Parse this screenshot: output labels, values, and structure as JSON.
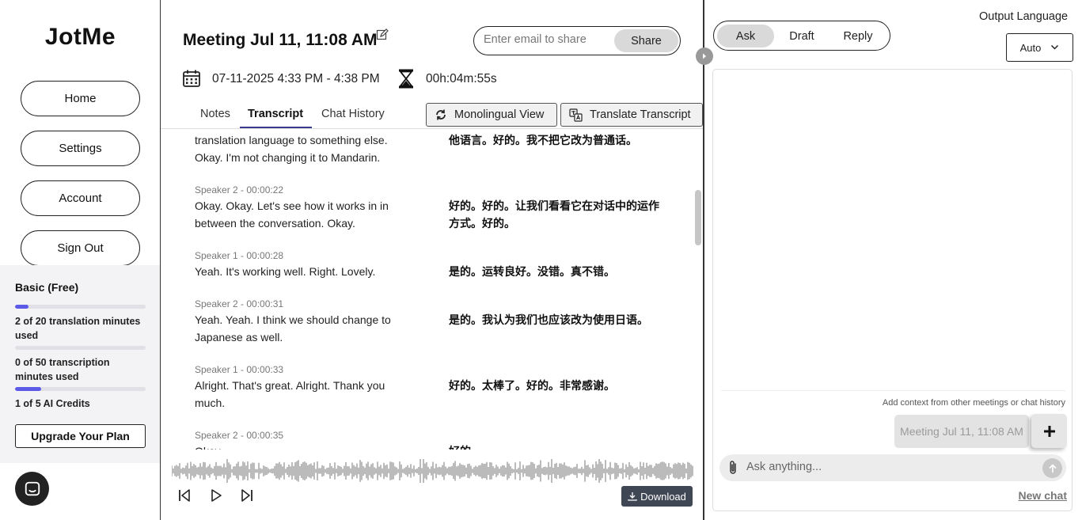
{
  "app": {
    "logo": "JotMe"
  },
  "sidebar": {
    "nav": [
      {
        "label": "Home"
      },
      {
        "label": "Settings"
      },
      {
        "label": "Account"
      },
      {
        "label": "Sign Out"
      }
    ],
    "plan": {
      "title": "Basic (Free)",
      "translation_text": "2 of 20 translation minutes used",
      "translation_progress": 0.1,
      "transcription_text": "0 of 50 transcription minutes used",
      "transcription_progress": 0.0,
      "ai_text": "1 of 5 AI Credits",
      "ai_progress": 0.2,
      "upgrade_label": "Upgrade Your Plan"
    }
  },
  "meeting": {
    "title": "Meeting Jul 11, 11:08 AM",
    "share_placeholder": "Enter email to share",
    "share_label": "Share",
    "datetime": "07-11-2025 4:33 PM - 4:38 PM",
    "duration": "00h:04m:55s",
    "tabs": [
      {
        "label": "Notes"
      },
      {
        "label": "Transcript"
      },
      {
        "label": "Chat History"
      }
    ],
    "monolingual_label": "Monolingual View",
    "translate_label": "Translate Transcript",
    "download_label": "Download"
  },
  "transcript": [
    {
      "speaker": "",
      "en": "translation language to something else. Okay. I'm not changing it to Mandarin.",
      "zh": "他语言。好的。我不把它改为普通话。"
    },
    {
      "speaker": "Speaker 2 - 00:00:22",
      "en": "Okay. Okay. Let's see how it works in in between the conversation. Okay.",
      "zh": "好的。好的。让我们看看它在对话中的运作方式。好的。"
    },
    {
      "speaker": "Speaker 1 - 00:00:28",
      "en": "Yeah. It's working well. Right. Lovely.",
      "zh": "是的。运转良好。没错。真不错。"
    },
    {
      "speaker": "Speaker 2 - 00:00:31",
      "en": "Yeah. Yeah. I think we should change to Japanese as well.",
      "zh": "是的。我认为我们也应该改为使用日语。"
    },
    {
      "speaker": "Speaker 1 - 00:00:33",
      "en": "Alright. That's great. Alright. Thank you much.",
      "zh": "好的。太棒了。好的。非常感谢。"
    },
    {
      "speaker": "Speaker 2 - 00:00:35",
      "en": "Okay.",
      "zh": "好的。"
    }
  ],
  "assistant": {
    "modes": [
      {
        "label": "Ask"
      },
      {
        "label": "Draft"
      },
      {
        "label": "Reply"
      }
    ],
    "output_language_label": "Output Language",
    "output_language_value": "Auto",
    "context_hint": "Add context from other meetings or chat history",
    "context_chip": "Meeting Jul 11, 11:08 AM",
    "ask_placeholder": "Ask anything...",
    "new_chat_label": "New chat"
  }
}
